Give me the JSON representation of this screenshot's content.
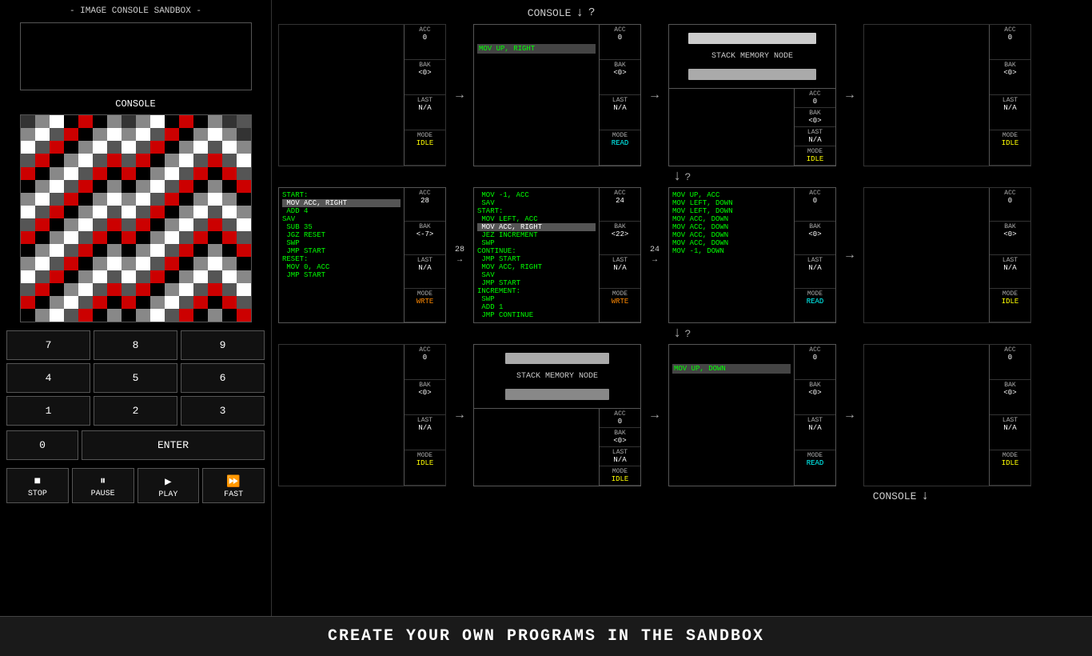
{
  "app": {
    "title": "- IMAGE CONSOLE SANDBOX -",
    "footer": "CREATE YOUR OWN PROGRAMS IN THE SANDBOX"
  },
  "console_label": "CONSOLE",
  "console_top": {
    "label": "CONSOLE",
    "arrow": "↓",
    "question": "?"
  },
  "console_bottom": {
    "label": "CONSOLE",
    "arrow": "↓"
  },
  "numpad": {
    "buttons": [
      "7",
      "8",
      "9",
      "4",
      "5",
      "6",
      "1",
      "2",
      "3"
    ],
    "zero": "0",
    "enter": "ENTER"
  },
  "transport": {
    "stop_icon": "■",
    "stop_label": "STOP",
    "pause_icon": "⏸",
    "pause_label": "PAUSE",
    "play_icon": "▶",
    "play_label": "PLAY",
    "fast_icon": "⏩",
    "fast_label": "FAST"
  },
  "nodes": {
    "row0": {
      "n0": {
        "code": "",
        "acc": "0",
        "bak": "<0>",
        "last": "N/A",
        "mode": "IDLE",
        "empty": true
      },
      "arrow01": {
        "symbol": "→"
      },
      "n1": {
        "header": "MOV UP, RIGHT",
        "code": "",
        "acc": "0",
        "bak": "<0>",
        "last": "N/A",
        "mode": "READ"
      },
      "arrow12": {
        "symbol": "→"
      },
      "n2": {
        "type": "stack",
        "label": "STACK MEMORY NODE",
        "acc": "0",
        "bak": "<0>",
        "last": "N/A",
        "mode": "IDLE"
      },
      "arrow23": {
        "symbol": "→"
      },
      "n3": {
        "code": "",
        "acc": "0",
        "bak": "<0>",
        "last": "N/A",
        "mode": "IDLE",
        "empty": true
      }
    },
    "row0_down": {
      "symbol": "↓",
      "question": "?"
    },
    "row1": {
      "n0": {
        "code": "START:\n MOV ACC, RIGHT\n ADD 4\nSAV\n SUB 35\n JGZ RESET\n SWP\n JMP START\n\nRESET:\n MOV 0, ACC\n JMP START",
        "highlight": "MOV ACC, RIGHT",
        "acc": "28",
        "bak": "<-7>",
        "last": "N/A",
        "mode": "WRTE"
      },
      "arrow01": {
        "symbol": "→",
        "value": "28"
      },
      "n1": {
        "code": " MOV -1, ACC\n SAV\nSTART:\n MOV LEFT, ACC\n MOV ACC, RIGHT\n JEZ INCREMENT\n SWP\nCONTINUE:\n JMP START\n MOV ACC, RIGHT\n SAV\n JMP START\nINCREMENT:\n SWP\n ADD 1\n JMP CONTINUE",
        "highlight": "MOV ACC, RIGHT",
        "acc": "24",
        "bak": "<22>",
        "last": "N/A",
        "mode": "WRTE"
      },
      "arrow12": {
        "symbol": "→",
        "value": "24"
      },
      "n2": {
        "code": "MOV UP, ACC\nMOV LEFT, DOWN\nMOV LEFT, DOWN\nMOV ACC, DOWN\nMOV ACC, DOWN\nMOV ACC, DOWN\nMOV ACC, DOWN\nMOV -1, DOWN",
        "acc": "0",
        "bak": "<0>",
        "last": "N/A",
        "mode": "READ"
      },
      "arrow23": {
        "symbol": "→"
      },
      "n3": {
        "code": "",
        "acc": "0",
        "bak": "<0>",
        "last": "N/A",
        "mode": "IDLE",
        "empty": true
      }
    },
    "row1_down": {
      "symbol": "↓",
      "question": "?"
    },
    "row2": {
      "n0": {
        "code": "",
        "acc": "0",
        "bak": "<0>",
        "last": "N/A",
        "mode": "IDLE",
        "empty": true
      },
      "arrow01": {
        "symbol": "→"
      },
      "n1": {
        "type": "stack",
        "label": "STACK MEMORY NODE",
        "acc": "0",
        "bak": "<0>",
        "last": "N/A",
        "mode": "IDLE"
      },
      "arrow12": {
        "symbol": "→"
      },
      "n2": {
        "header": "MOV UP, DOWN",
        "code": "",
        "acc": "0",
        "bak": "<0>",
        "last": "N/A",
        "mode": "READ"
      },
      "arrow23": {
        "symbol": "→"
      },
      "n3": {
        "code": "",
        "acc": "0",
        "bak": "<0>",
        "last": "N/A",
        "mode": "IDLE",
        "empty": true
      }
    }
  },
  "pixels": [
    [
      "#333",
      "#888",
      "#fff",
      "#000",
      "#c00",
      "#000",
      "#888",
      "#333",
      "#888",
      "#fff",
      "#000",
      "#c00",
      "#000",
      "#888",
      "#333",
      "#555"
    ],
    [
      "#888",
      "#fff",
      "#555",
      "#c00",
      "#000",
      "#888",
      "#fff",
      "#888",
      "#fff",
      "#555",
      "#c00",
      "#000",
      "#888",
      "#fff",
      "#888",
      "#333"
    ],
    [
      "#fff",
      "#555",
      "#c00",
      "#000",
      "#888",
      "#fff",
      "#555",
      "#fff",
      "#555",
      "#c00",
      "#000",
      "#888",
      "#fff",
      "#555",
      "#fff",
      "#888"
    ],
    [
      "#555",
      "#c00",
      "#000",
      "#888",
      "#fff",
      "#555",
      "#c00",
      "#555",
      "#c00",
      "#000",
      "#888",
      "#fff",
      "#555",
      "#c00",
      "#555",
      "#fff"
    ],
    [
      "#c00",
      "#000",
      "#888",
      "#fff",
      "#555",
      "#c00",
      "#000",
      "#c00",
      "#000",
      "#888",
      "#fff",
      "#555",
      "#c00",
      "#000",
      "#c00",
      "#555"
    ],
    [
      "#000",
      "#888",
      "#fff",
      "#555",
      "#c00",
      "#000",
      "#888",
      "#000",
      "#888",
      "#fff",
      "#555",
      "#c00",
      "#000",
      "#888",
      "#000",
      "#c00"
    ],
    [
      "#888",
      "#fff",
      "#555",
      "#c00",
      "#000",
      "#888",
      "#fff",
      "#888",
      "#fff",
      "#555",
      "#c00",
      "#000",
      "#888",
      "#fff",
      "#888",
      "#000"
    ],
    [
      "#fff",
      "#555",
      "#c00",
      "#000",
      "#888",
      "#fff",
      "#555",
      "#fff",
      "#555",
      "#c00",
      "#000",
      "#888",
      "#fff",
      "#555",
      "#fff",
      "#888"
    ],
    [
      "#555",
      "#c00",
      "#000",
      "#888",
      "#fff",
      "#555",
      "#c00",
      "#555",
      "#c00",
      "#000",
      "#888",
      "#fff",
      "#555",
      "#c00",
      "#555",
      "#fff"
    ],
    [
      "#c00",
      "#000",
      "#888",
      "#fff",
      "#555",
      "#c00",
      "#000",
      "#c00",
      "#000",
      "#888",
      "#fff",
      "#555",
      "#c00",
      "#000",
      "#c00",
      "#555"
    ],
    [
      "#000",
      "#888",
      "#fff",
      "#555",
      "#c00",
      "#000",
      "#888",
      "#000",
      "#888",
      "#fff",
      "#555",
      "#c00",
      "#000",
      "#888",
      "#000",
      "#c00"
    ],
    [
      "#888",
      "#fff",
      "#555",
      "#c00",
      "#000",
      "#888",
      "#fff",
      "#888",
      "#fff",
      "#555",
      "#c00",
      "#000",
      "#888",
      "#fff",
      "#888",
      "#000"
    ],
    [
      "#fff",
      "#555",
      "#c00",
      "#000",
      "#888",
      "#fff",
      "#555",
      "#fff",
      "#555",
      "#c00",
      "#000",
      "#888",
      "#fff",
      "#555",
      "#fff",
      "#888"
    ],
    [
      "#555",
      "#c00",
      "#000",
      "#888",
      "#fff",
      "#555",
      "#c00",
      "#555",
      "#c00",
      "#000",
      "#888",
      "#fff",
      "#555",
      "#c00",
      "#555",
      "#fff"
    ],
    [
      "#c00",
      "#000",
      "#888",
      "#fff",
      "#555",
      "#c00",
      "#000",
      "#c00",
      "#000",
      "#888",
      "#fff",
      "#555",
      "#c00",
      "#000",
      "#c00",
      "#555"
    ],
    [
      "#000",
      "#888",
      "#fff",
      "#555",
      "#c00",
      "#000",
      "#888",
      "#000",
      "#888",
      "#fff",
      "#555",
      "#c00",
      "#000",
      "#888",
      "#000",
      "#c00"
    ]
  ]
}
